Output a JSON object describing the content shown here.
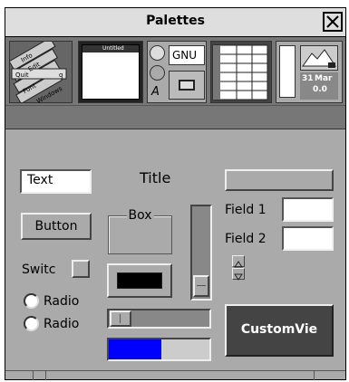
{
  "window": {
    "title": "Palettes"
  },
  "toolbar": {
    "menu_icon_items": [
      "Info",
      "Edit",
      "Quit",
      "q",
      "Font",
      "Windows"
    ],
    "window_icon_label": "Untitled",
    "gnu_label": "GNU",
    "a_label": "A",
    "date_day": "31",
    "date_month": "Mar",
    "date_value": "0.0"
  },
  "controls": {
    "text_field_value": "Text",
    "title_label": "Title",
    "button_label": "Button",
    "box_title": "Box",
    "field1_label": "Field 1",
    "field2_label": "Field 2",
    "switch_label": "Switc",
    "radio1_label": "Radio",
    "radio2_label": "Radio",
    "custom_view_label": "CustomVie",
    "progress_fraction": 0.52
  },
  "colors": {
    "custom_view_bg": "#444444",
    "progress_fill": "#0000ff",
    "color_well": "#000000"
  }
}
